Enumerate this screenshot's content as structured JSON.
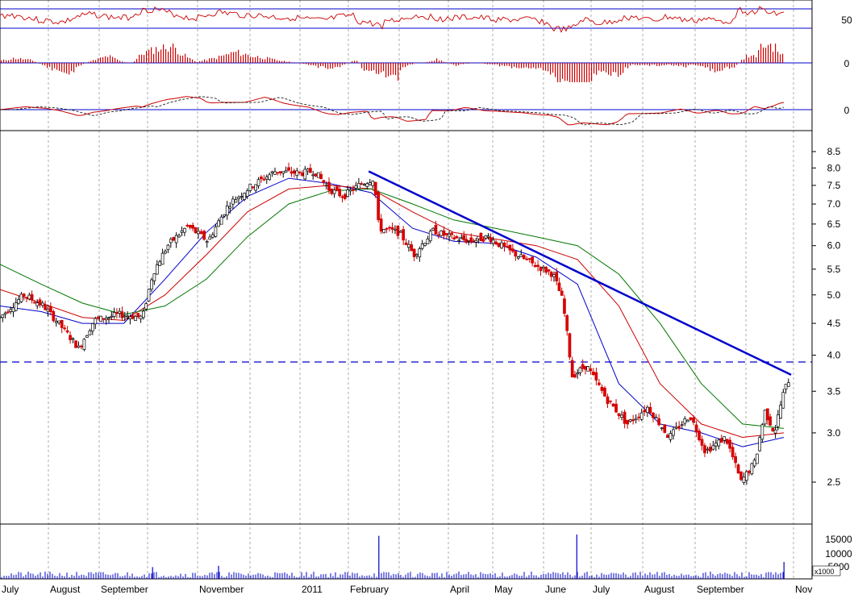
{
  "chart_data": {
    "type": "candlestick",
    "x_labels": [
      "July",
      "August",
      "September",
      "November",
      "2011",
      "February",
      "April",
      "May",
      "June",
      "July",
      "August",
      "September",
      "Nov"
    ],
    "price_axis": {
      "scale": "log",
      "ticks": [
        2.5,
        3.0,
        3.5,
        4.0,
        4.5,
        5.0,
        5.5,
        6.0,
        6.5,
        7.0,
        7.5,
        8.0,
        8.5
      ]
    },
    "rsi_axis": {
      "ticks": [
        "50"
      ]
    },
    "momentum_axis": {
      "ticks": [
        "0"
      ]
    },
    "macd_axis": {
      "ticks": [
        "0"
      ]
    },
    "volume_axis": {
      "ticks": [
        "15000",
        "10000",
        "5000"
      ],
      "unit": "x1000"
    },
    "support_level": 3.9,
    "trendline": {
      "start": {
        "x": "February",
        "y": 7.9
      },
      "end": {
        "x": "Nov",
        "y": 3.72
      }
    },
    "moving_averages": [
      {
        "color": "#0000cc",
        "points": [
          4.8,
          4.7,
          4.5,
          4.5,
          5.3,
          6.3,
          7.2,
          7.7,
          7.55,
          7.3,
          6.4,
          6.1,
          6.05,
          5.75,
          5.2,
          3.6,
          3.1,
          3.0,
          2.85,
          2.95
        ]
      },
      {
        "color": "#cc0000",
        "points": [
          5.1,
          4.85,
          4.6,
          4.55,
          5.0,
          5.8,
          6.8,
          7.4,
          7.5,
          7.4,
          6.8,
          6.3,
          6.15,
          6.0,
          5.7,
          4.8,
          3.6,
          3.1,
          2.95,
          3.0
        ]
      },
      {
        "color": "#007700",
        "points": [
          5.6,
          5.2,
          4.85,
          4.65,
          4.8,
          5.3,
          6.2,
          7.0,
          7.35,
          7.4,
          7.0,
          6.6,
          6.4,
          6.2,
          6.0,
          5.4,
          4.5,
          3.6,
          3.1,
          3.05
        ]
      }
    ],
    "price_path": [
      {
        "m": 0.0,
        "v": 4.6
      },
      {
        "m": 0.5,
        "v": 5.0
      },
      {
        "m": 0.9,
        "v": 4.8
      },
      {
        "m": 1.3,
        "v": 4.4
      },
      {
        "m": 1.6,
        "v": 4.1
      },
      {
        "m": 1.9,
        "v": 4.55
      },
      {
        "m": 2.4,
        "v": 4.65
      },
      {
        "m": 2.9,
        "v": 4.6
      },
      {
        "m": 3.1,
        "v": 5.4
      },
      {
        "m": 3.4,
        "v": 6.0
      },
      {
        "m": 3.8,
        "v": 6.45
      },
      {
        "m": 4.2,
        "v": 6.1
      },
      {
        "m": 4.6,
        "v": 7.0
      },
      {
        "m": 5.0,
        "v": 7.45
      },
      {
        "m": 5.5,
        "v": 7.9
      },
      {
        "m": 6.0,
        "v": 7.85
      },
      {
        "m": 6.3,
        "v": 7.9
      },
      {
        "m": 6.6,
        "v": 7.4
      },
      {
        "m": 6.9,
        "v": 7.2
      },
      {
        "m": 7.2,
        "v": 7.5
      },
      {
        "m": 7.5,
        "v": 7.7
      },
      {
        "m": 7.6,
        "v": 6.4
      },
      {
        "m": 8.0,
        "v": 6.3
      },
      {
        "m": 8.3,
        "v": 5.8
      },
      {
        "m": 8.7,
        "v": 6.35
      },
      {
        "m": 9.0,
        "v": 6.2
      },
      {
        "m": 9.5,
        "v": 6.1
      },
      {
        "m": 9.9,
        "v": 6.2
      },
      {
        "m": 10.3,
        "v": 5.9
      },
      {
        "m": 10.8,
        "v": 5.6
      },
      {
        "m": 11.2,
        "v": 5.4
      },
      {
        "m": 11.4,
        "v": 4.9
      },
      {
        "m": 11.6,
        "v": 3.7
      },
      {
        "m": 11.9,
        "v": 3.85
      },
      {
        "m": 12.3,
        "v": 3.4
      },
      {
        "m": 12.7,
        "v": 3.1
      },
      {
        "m": 13.1,
        "v": 3.3
      },
      {
        "m": 13.5,
        "v": 2.95
      },
      {
        "m": 13.9,
        "v": 3.2
      },
      {
        "m": 14.2,
        "v": 2.8
      },
      {
        "m": 14.6,
        "v": 2.95
      },
      {
        "m": 14.9,
        "v": 2.5
      },
      {
        "m": 15.2,
        "v": 2.7
      },
      {
        "m": 15.4,
        "v": 3.25
      },
      {
        "m": 15.6,
        "v": 3.0
      },
      {
        "m": 15.8,
        "v": 3.5
      },
      {
        "m": 15.9,
        "v": 3.65
      }
    ],
    "volume_spikes": [
      {
        "m": 7.6,
        "v": 16500
      },
      {
        "m": 11.7,
        "v": 17000
      },
      {
        "m": 15.8,
        "v": 6500
      },
      {
        "m": 3.1,
        "v": 4500
      },
      {
        "m": 4.4,
        "v": 5000
      }
    ]
  }
}
